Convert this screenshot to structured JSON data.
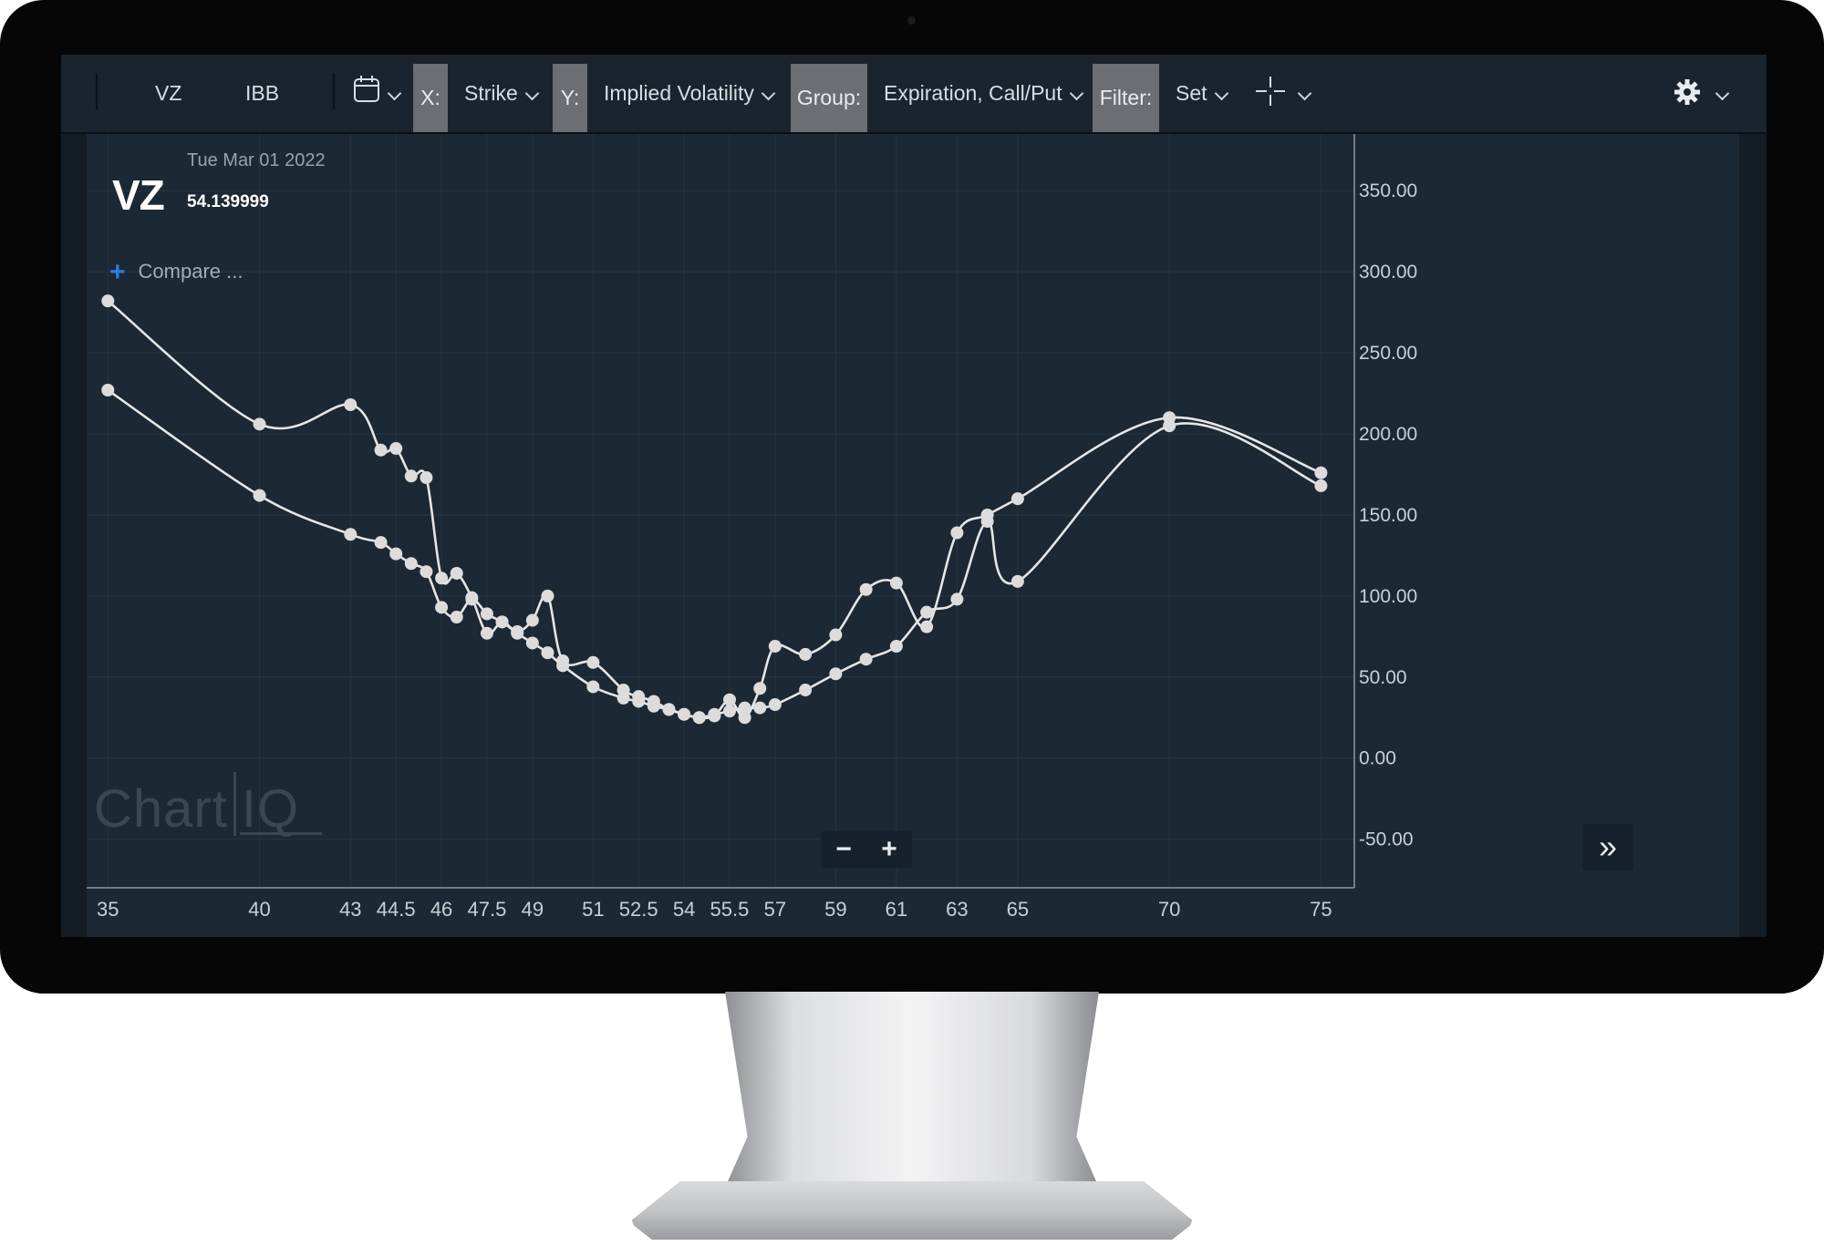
{
  "toolbar": {
    "symbols": [
      "VZ",
      "IBB"
    ],
    "x_tag": "X:",
    "x_value": "Strike",
    "y_tag": "Y:",
    "y_value": "Implied Volatility",
    "group_tag": "Group:",
    "group_value": "Expiration, Call/Put",
    "filter_tag": "Filter:",
    "filter_value": "Set",
    "icons": [
      "calendar-icon",
      "crosshair-icon",
      "gear-icon"
    ]
  },
  "header": {
    "date": "Tue Mar 01 2022",
    "symbol": "VZ",
    "price": "54.139999",
    "compare_label": "Compare ..."
  },
  "logo": {
    "text_left": "Chart",
    "text_right": "IQ"
  },
  "controls": {
    "zoom_out": "−",
    "zoom_in": "+",
    "fast_forward": "»"
  },
  "colors": {
    "series": "#e6e6e6",
    "background": "#1c2833",
    "accent": "#2b7de0"
  },
  "chart_data": {
    "type": "line",
    "x_ticks": [
      "35",
      "40",
      "43",
      "44.5",
      "46",
      "47.5",
      "49",
      "51",
      "52.5",
      "54",
      "55.5",
      "57",
      "59",
      "61",
      "63",
      "65",
      "70",
      "75"
    ],
    "y_ticks": [
      "350.00",
      "300.00",
      "250.00",
      "200.00",
      "150.00",
      "100.00",
      "50.00",
      "0.00",
      "-50.00"
    ],
    "xlim": [
      34.3,
      76.1
    ],
    "ylim": [
      -80,
      385
    ],
    "grid": true,
    "series": [
      {
        "values": [
          [
            35,
            282
          ],
          [
            40,
            206
          ],
          [
            43,
            218
          ],
          [
            44,
            190
          ],
          [
            44.5,
            191
          ],
          [
            45,
            174
          ],
          [
            45.5,
            173
          ],
          [
            46,
            111
          ],
          [
            46.5,
            114
          ],
          [
            47,
            99
          ],
          [
            47.5,
            77
          ],
          [
            48,
            84
          ],
          [
            48.5,
            78
          ],
          [
            49,
            85
          ],
          [
            49.5,
            100
          ],
          [
            50,
            60
          ],
          [
            51,
            59
          ],
          [
            52,
            42
          ],
          [
            52.5,
            38
          ],
          [
            53,
            35
          ],
          [
            53.5,
            30
          ],
          [
            54,
            27
          ],
          [
            54.5,
            25
          ],
          [
            55,
            26
          ],
          [
            55.5,
            36
          ],
          [
            56,
            25
          ],
          [
            56.5,
            43
          ],
          [
            57,
            69
          ],
          [
            58,
            64
          ],
          [
            59,
            76
          ],
          [
            60,
            104
          ],
          [
            61,
            108
          ],
          [
            62,
            81
          ],
          [
            63,
            139
          ],
          [
            64,
            150
          ],
          [
            65,
            160
          ],
          [
            70,
            210
          ],
          [
            75,
            176
          ]
        ]
      },
      {
        "values": [
          [
            35,
            227
          ],
          [
            40,
            162
          ],
          [
            43,
            138
          ],
          [
            44,
            133
          ],
          [
            44.5,
            126
          ],
          [
            45,
            120
          ],
          [
            45.5,
            115
          ],
          [
            46,
            93
          ],
          [
            46.5,
            87
          ],
          [
            47,
            98
          ],
          [
            47.5,
            89
          ],
          [
            48,
            84
          ],
          [
            48.5,
            77
          ],
          [
            49,
            71
          ],
          [
            49.5,
            65
          ],
          [
            50,
            57
          ],
          [
            51,
            44
          ],
          [
            52,
            37
          ],
          [
            52.5,
            35
          ],
          [
            53,
            32
          ],
          [
            53.5,
            30
          ],
          [
            54,
            27
          ],
          [
            54.5,
            25
          ],
          [
            55,
            27
          ],
          [
            55.5,
            29
          ],
          [
            56,
            31
          ],
          [
            56.5,
            31
          ],
          [
            57,
            33
          ],
          [
            58,
            42
          ],
          [
            59,
            52
          ],
          [
            60,
            61
          ],
          [
            61,
            69
          ],
          [
            62,
            90
          ],
          [
            63,
            98
          ],
          [
            64,
            146
          ],
          [
            65,
            109
          ],
          [
            70,
            205
          ],
          [
            75,
            168
          ]
        ]
      }
    ]
  }
}
